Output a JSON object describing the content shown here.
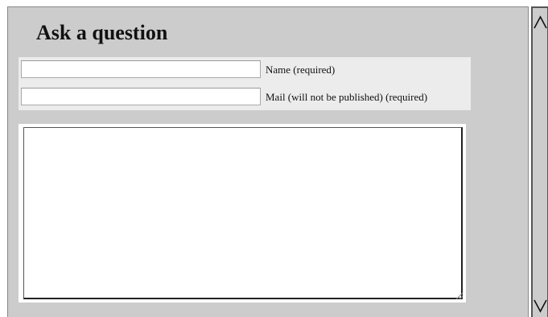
{
  "form": {
    "title": "Ask a question",
    "name_label": "Name (required)",
    "name_value": "",
    "mail_label": "Mail (will not be published) (required)",
    "mail_value": "",
    "comment_value": ""
  },
  "scrollbar": {
    "up_icon": "chevron-up-icon",
    "down_icon": "chevron-down-icon"
  },
  "colors": {
    "panel_bg": "#cccccc",
    "fields_bg": "#ececec",
    "input_bg": "#ffffff"
  }
}
